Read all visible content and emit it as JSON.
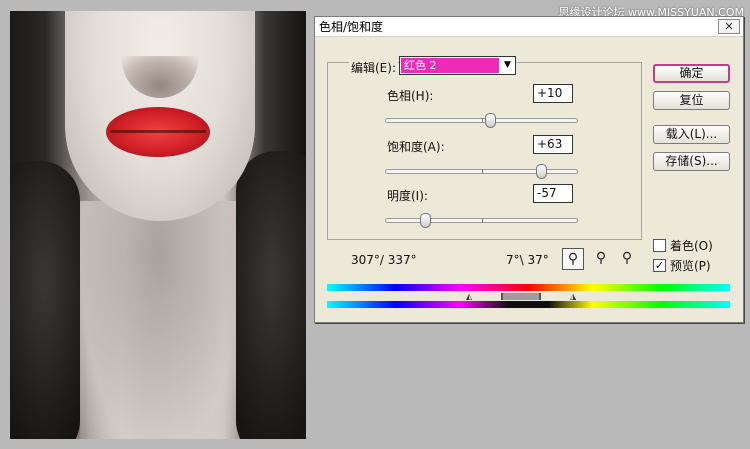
{
  "watermark": "思缘设计论坛 www.MISSYUAN.COM",
  "dialog": {
    "title": "色相/饱和度",
    "close": "✕",
    "edit_label": "编辑(E):",
    "edit_value": "红色 2",
    "hue": {
      "label": "色相(H):",
      "value": "+10",
      "level": 0.55
    },
    "saturation": {
      "label": "饱和度(A):",
      "value": "+63",
      "level": 0.815
    },
    "lightness": {
      "label": "明度(I):",
      "value": "-57",
      "level": 0.215
    },
    "range_left": "307°/ 337°",
    "range_right": "7°\\ 37°",
    "buttons": {
      "ok": "确定",
      "reset": "复位",
      "load": "载入(L)...",
      "save": "存储(S)..."
    },
    "colorize": {
      "label": "着色(O)",
      "checked": false
    },
    "preview": {
      "label": "预览(P)",
      "checked": true,
      "mark": "✓"
    }
  }
}
